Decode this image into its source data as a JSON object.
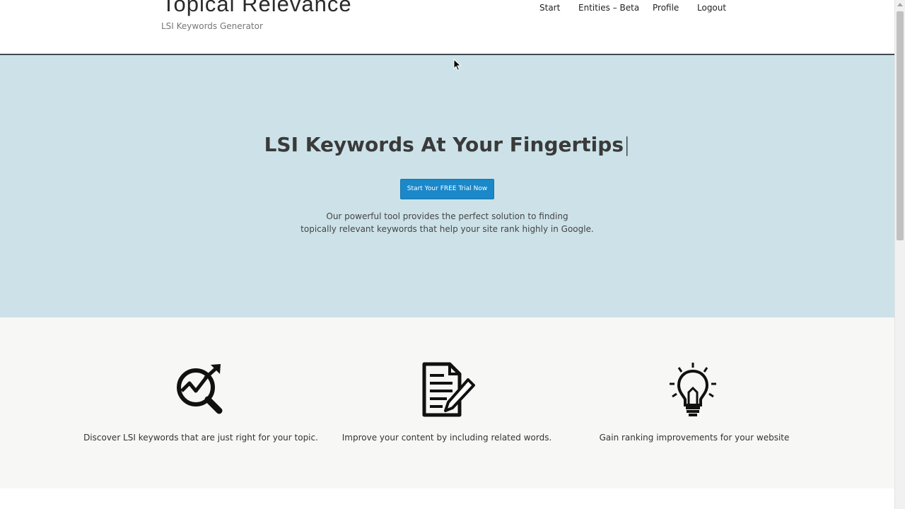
{
  "header": {
    "brand_title": "Topical Relevance",
    "brand_tagline": "LSI Keywords Generator",
    "nav": [
      "Start",
      "Entities – Beta",
      "Profile",
      "Logout"
    ]
  },
  "hero": {
    "heading": "LSI Keywords At Your Fingertips",
    "caret": "|",
    "cta_label": "Start Your FREE Trial Now",
    "description_line1": "Our powerful tool provides the perfect solution to finding",
    "description_line2": "topically relevant keywords that help your site rank highly in Google."
  },
  "features": [
    {
      "icon": "analytics-magnifier-icon",
      "text": "Discover LSI keywords that are just right for your topic."
    },
    {
      "icon": "document-pencil-icon",
      "text": "Improve your content by including related words."
    },
    {
      "icon": "lightbulb-icon",
      "text": "Gain ranking improvements for your website"
    }
  ],
  "colors": {
    "hero_background": "#cce2e8",
    "cta_background": "#1a88c9",
    "features_background": "#f7f7f5",
    "header_border": "#3f4a52"
  }
}
